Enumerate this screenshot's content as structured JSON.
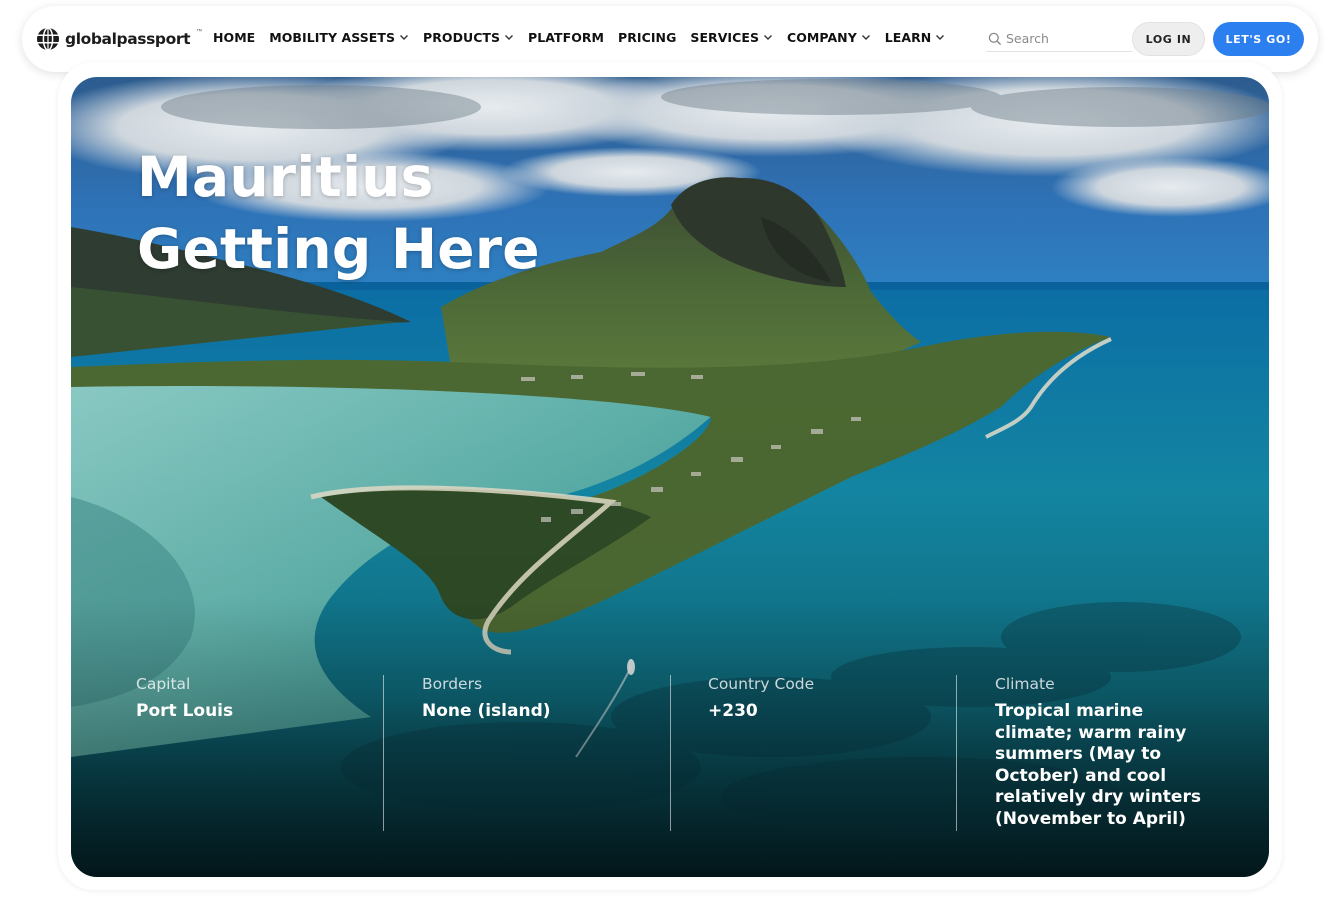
{
  "brand": {
    "name": "globalpassport",
    "trademark": "™"
  },
  "nav": {
    "items": [
      {
        "label": "HOME",
        "has_dropdown": false
      },
      {
        "label": "MOBILITY ASSETS",
        "has_dropdown": true
      },
      {
        "label": "PRODUCTS",
        "has_dropdown": true
      },
      {
        "label": "PLATFORM",
        "has_dropdown": false
      },
      {
        "label": "PRICING",
        "has_dropdown": false
      },
      {
        "label": "SERVICES",
        "has_dropdown": true
      },
      {
        "label": "COMPANY",
        "has_dropdown": true
      },
      {
        "label": "LEARN",
        "has_dropdown": true
      }
    ],
    "search_placeholder": "Search",
    "login_label": "LOG IN",
    "cta_label": "LET'S GO!"
  },
  "hero": {
    "title_line1": "Mauritius",
    "title_line2": "Getting Here",
    "facts": [
      {
        "label": "Capital",
        "value": "Port Louis"
      },
      {
        "label": "Borders",
        "value": "None (island)"
      },
      {
        "label": "Country Code",
        "value": "+230"
      },
      {
        "label": "Climate",
        "value": "Tropical marine climate; warm rainy summers (May to October) and cool relatively dry winters (November to April)"
      }
    ]
  },
  "colors": {
    "accent": "#2b7fef",
    "nav_text": "#111111",
    "hero_text": "#ffffff"
  }
}
